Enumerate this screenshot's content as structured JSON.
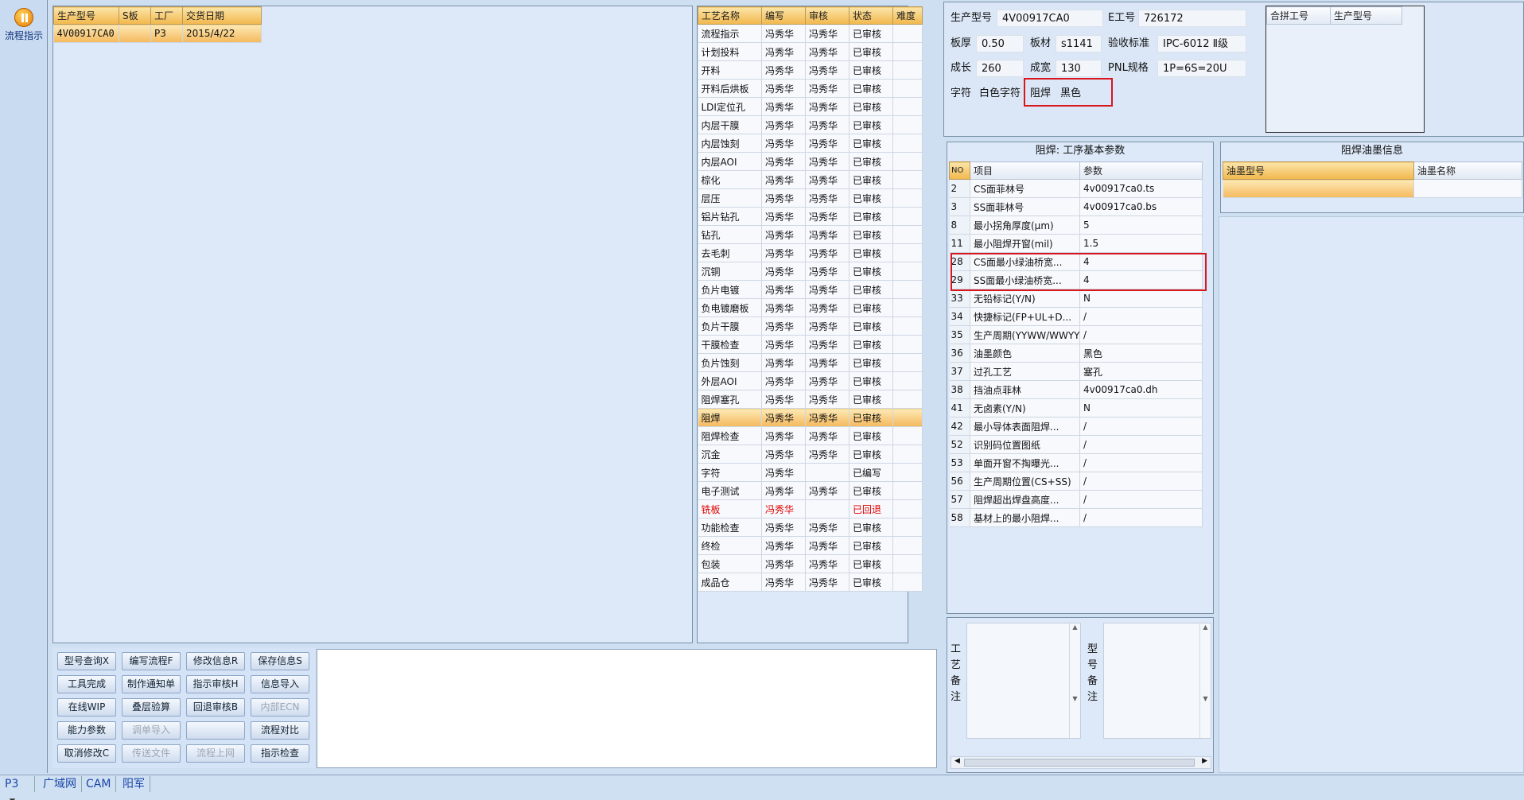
{
  "sidebar": {
    "flow_label": "流程指示"
  },
  "orders": {
    "headers": [
      "生产型号",
      "S板",
      "工厂",
      "交货日期"
    ],
    "rows": [
      {
        "model": "4V00917CA0",
        "s": "",
        "factory": "P3",
        "date": "2015/4/22"
      }
    ]
  },
  "process": {
    "headers": [
      "工艺名称",
      "编写",
      "审核",
      "状态",
      "难度"
    ],
    "rows": [
      {
        "name": "流程指示",
        "writer": "冯秀华",
        "reviewer": "冯秀华",
        "status": "已审核"
      },
      {
        "name": "计划投料",
        "writer": "冯秀华",
        "reviewer": "冯秀华",
        "status": "已审核"
      },
      {
        "name": "开料",
        "writer": "冯秀华",
        "reviewer": "冯秀华",
        "status": "已审核"
      },
      {
        "name": "开料后烘板",
        "writer": "冯秀华",
        "reviewer": "冯秀华",
        "status": "已审核"
      },
      {
        "name": "LDI定位孔",
        "writer": "冯秀华",
        "reviewer": "冯秀华",
        "status": "已审核"
      },
      {
        "name": "内层干膜",
        "writer": "冯秀华",
        "reviewer": "冯秀华",
        "status": "已审核"
      },
      {
        "name": "内层蚀刻",
        "writer": "冯秀华",
        "reviewer": "冯秀华",
        "status": "已审核"
      },
      {
        "name": "内层AOI",
        "writer": "冯秀华",
        "reviewer": "冯秀华",
        "status": "已审核"
      },
      {
        "name": "棕化",
        "writer": "冯秀华",
        "reviewer": "冯秀华",
        "status": "已审核"
      },
      {
        "name": "层压",
        "writer": "冯秀华",
        "reviewer": "冯秀华",
        "status": "已审核"
      },
      {
        "name": "铝片钻孔",
        "writer": "冯秀华",
        "reviewer": "冯秀华",
        "status": "已审核"
      },
      {
        "name": "钻孔",
        "writer": "冯秀华",
        "reviewer": "冯秀华",
        "status": "已审核"
      },
      {
        "name": "去毛刺",
        "writer": "冯秀华",
        "reviewer": "冯秀华",
        "status": "已审核"
      },
      {
        "name": "沉铜",
        "writer": "冯秀华",
        "reviewer": "冯秀华",
        "status": "已审核"
      },
      {
        "name": "负片电镀",
        "writer": "冯秀华",
        "reviewer": "冯秀华",
        "status": "已审核"
      },
      {
        "name": "负电镀磨板",
        "writer": "冯秀华",
        "reviewer": "冯秀华",
        "status": "已审核"
      },
      {
        "name": "负片干膜",
        "writer": "冯秀华",
        "reviewer": "冯秀华",
        "status": "已审核"
      },
      {
        "name": "干膜检查",
        "writer": "冯秀华",
        "reviewer": "冯秀华",
        "status": "已审核"
      },
      {
        "name": "负片蚀刻",
        "writer": "冯秀华",
        "reviewer": "冯秀华",
        "status": "已审核"
      },
      {
        "name": "外层AOI",
        "writer": "冯秀华",
        "reviewer": "冯秀华",
        "status": "已审核"
      },
      {
        "name": "阻焊塞孔",
        "writer": "冯秀华",
        "reviewer": "冯秀华",
        "status": "已审核"
      },
      {
        "name": "阻焊",
        "writer": "冯秀华",
        "reviewer": "冯秀华",
        "status": "已审核",
        "selected": true
      },
      {
        "name": "阻焊检查",
        "writer": "冯秀华",
        "reviewer": "冯秀华",
        "status": "已审核"
      },
      {
        "name": "沉金",
        "writer": "冯秀华",
        "reviewer": "冯秀华",
        "status": "已审核"
      },
      {
        "name": "字符",
        "writer": "冯秀华",
        "reviewer": "",
        "status": "已编写"
      },
      {
        "name": "电子测试",
        "writer": "冯秀华",
        "reviewer": "冯秀华",
        "status": "已审核"
      },
      {
        "name": "铣板",
        "writer": "冯秀华",
        "reviewer": "",
        "status": "已回退",
        "red": true
      },
      {
        "name": "功能检查",
        "writer": "冯秀华",
        "reviewer": "冯秀华",
        "status": "已审核"
      },
      {
        "name": "终检",
        "writer": "冯秀华",
        "reviewer": "冯秀华",
        "status": "已审核"
      },
      {
        "name": "包装",
        "writer": "冯秀华",
        "reviewer": "冯秀华",
        "status": "已审核"
      },
      {
        "name": "成品仓",
        "writer": "冯秀华",
        "reviewer": "冯秀华",
        "status": "已审核"
      }
    ]
  },
  "info": {
    "model_label": "生产型号",
    "model_value": "4V00917CA0",
    "eno_label": "E工号",
    "eno_value": "726172",
    "thickness_label": "板厚",
    "thickness_value": "0.50",
    "material_label": "板材",
    "material_value": "s1141",
    "standard_label": "验收标准",
    "standard_value": "IPC-6012 Ⅱ级",
    "length_label": "成长",
    "length_value": "260",
    "width_label": "成宽",
    "width_value": "130",
    "pnl_label": "PNL规格",
    "pnl_value": "1P=6S=20U",
    "char_label": "字符",
    "char_value": "白色字符",
    "mask_label": "阻焊",
    "mask_value": "黑色"
  },
  "combined": {
    "headers": [
      "合拼工号",
      "生产型号"
    ]
  },
  "params": {
    "title": "阻焊: 工序基本参数",
    "headers": [
      "NO",
      "项目",
      "参数"
    ],
    "rows": [
      {
        "no": "2",
        "item": "CS面菲林号",
        "value": "4v00917ca0.ts"
      },
      {
        "no": "3",
        "item": "SS面菲林号",
        "value": "4v00917ca0.bs"
      },
      {
        "no": "8",
        "item": "最小拐角厚度(μm)",
        "value": "5"
      },
      {
        "no": "11",
        "item": "最小阻焊开窗(mil)",
        "value": "1.5"
      },
      {
        "no": "28",
        "item": "CS面最小绿油桥宽...",
        "value": "4"
      },
      {
        "no": "29",
        "item": "SS面最小绿油桥宽...",
        "value": "4"
      },
      {
        "no": "33",
        "item": "无铅标记(Y/N)",
        "value": "N"
      },
      {
        "no": "34",
        "item": "快捷标记(FP+UL+D...",
        "value": "/"
      },
      {
        "no": "35",
        "item": "生产周期(YYWW/WWYY)",
        "value": "/"
      },
      {
        "no": "36",
        "item": "油墨颜色",
        "value": "黑色"
      },
      {
        "no": "37",
        "item": "过孔工艺",
        "value": "塞孔"
      },
      {
        "no": "38",
        "item": "挡油点菲林",
        "value": "4v00917ca0.dh"
      },
      {
        "no": "41",
        "item": "无卤素(Y/N)",
        "value": "N"
      },
      {
        "no": "42",
        "item": "最小导体表面阻焊...",
        "value": "/"
      },
      {
        "no": "52",
        "item": "识别码位置图纸",
        "value": "/"
      },
      {
        "no": "53",
        "item": "单面开窗不掏曝光...",
        "value": "/"
      },
      {
        "no": "56",
        "item": "生产周期位置(CS+SS)",
        "value": "/"
      },
      {
        "no": "57",
        "item": "阻焊超出焊盘高度...",
        "value": "/"
      },
      {
        "no": "58",
        "item": "基材上的最小阻焊...",
        "value": "/"
      }
    ]
  },
  "ink": {
    "title": "阻焊油墨信息",
    "headers": [
      "油墨型号",
      "油墨名称"
    ]
  },
  "notes": {
    "process_label": "工艺备注",
    "model_label": "型号备注"
  },
  "buttons": {
    "query": "型号查询X",
    "write_flow": "编写流程F",
    "modify": "修改信息R",
    "save": "保存信息S",
    "tool_done": "工具完成",
    "make_notice": "制作通知单",
    "review": "指示审核H",
    "import_info": "信息导入",
    "online_wip": "在线WIP",
    "stack_check": "叠层验算",
    "revert_review": "回退审核B",
    "internal_ecn": "内部ECN",
    "capability": "能力参数",
    "load_import": "调单导入",
    "blank": "",
    "flow_compare": "流程对比",
    "cancel_modify": "取消修改C",
    "send_file": "传送文件",
    "flow_upload": "流程上网",
    "check": "指示检查"
  },
  "statusbar": {
    "plant": "P3",
    "tabs": [
      "广域网",
      "CAM",
      "阳军"
    ]
  }
}
